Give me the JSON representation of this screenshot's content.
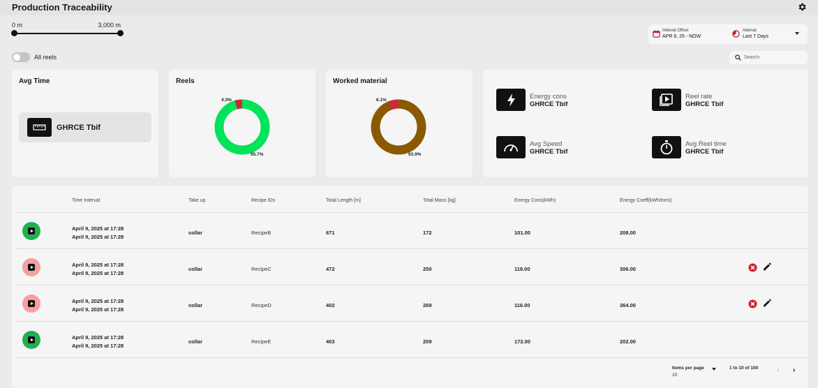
{
  "header": {
    "title": "Production Traceability",
    "settings_icon": "gear-icon"
  },
  "range": {
    "min_label": "0 m",
    "max_label": "3,000 m",
    "min_value": 0,
    "max_value": 3000
  },
  "filters": {
    "all_reels_label": "All reels",
    "all_reels_on": false,
    "interval_offset_title": "Interval Offset",
    "interval_offset_value": "APR 8, 25 - NOW",
    "interval_title": "Interval",
    "interval_value": "Last 7 Days",
    "search_placeholder": "Search"
  },
  "cards": {
    "avg_time": {
      "title": "Avg Time",
      "value": "GHRCE Tbif",
      "icon": "ruler-icon"
    },
    "reels": {
      "title": "Reels",
      "small_pct_label": "4.3%",
      "large_pct_label": "95.7%",
      "small_fraction": 0.043,
      "large_color": "#00e35a",
      "small_color": "#cc2a36"
    },
    "worked_material": {
      "title": "Worked material",
      "small_pct_label": "6.1%",
      "large_pct_label": "93.9%",
      "small_fraction": 0.061,
      "large_color": "#8a5a00",
      "small_color": "#cc2a36"
    },
    "kpis": [
      {
        "label": "Energy cons",
        "value": "GHRCE Tbif",
        "icon": "lightning-icon"
      },
      {
        "label": "Reel rate",
        "value": "GHRCE Tbif",
        "icon": "play-box-icon"
      },
      {
        "label": "Avg Speed",
        "value": "GHRCE Tbif",
        "icon": "speedometer-icon"
      },
      {
        "label": "Avg Reel time",
        "value": "GHRCE Tbif",
        "icon": "stopwatch-icon"
      }
    ]
  },
  "table": {
    "columns": [
      "Time Interval",
      "Take up",
      "Recipe IDs",
      "Total Length [m]",
      "Total Mass [kg]",
      "Energy Cons(kWh)",
      "Energy Coeff(kWh/tons)"
    ],
    "rows": [
      {
        "status_color": "#22b14c",
        "start": "April 9, 2025 at 17:28",
        "end": "April 9, 2025 at 17:28",
        "take_up": "collar",
        "recipe": "RecipeB",
        "length": "671",
        "mass": "172",
        "energy": "101.00",
        "coeff": "208.00",
        "actions": false
      },
      {
        "status_color": "#f4a0a0",
        "start": "April 9, 2025 at 17:28",
        "end": "April 9, 2025 at 17:28",
        "take_up": "collar",
        "recipe": "RecipeC",
        "length": "472",
        "mass": "250",
        "energy": "118.00",
        "coeff": "306.00",
        "actions": true
      },
      {
        "status_color": "#f4a0a0",
        "start": "April 9, 2025 at 17:28",
        "end": "April 9, 2025 at 17:28",
        "take_up": "collar",
        "recipe": "RecipeD",
        "length": "402",
        "mass": "269",
        "energy": "116.00",
        "coeff": "364.00",
        "actions": true
      },
      {
        "status_color": "#22b14c",
        "start": "April 9, 2025 at 17:28",
        "end": "April 9, 2025 at 17:28",
        "take_up": "collar",
        "recipe": "RecipeE",
        "length": "403",
        "mass": "209",
        "energy": "172.00",
        "coeff": "202.00",
        "actions": false
      }
    ]
  },
  "pagination": {
    "items_per_page_label": "Items per page",
    "items_per_page": "10",
    "range_label": "1 to 10 of 100",
    "prev_symbol": "‹",
    "next_symbol": "›"
  }
}
